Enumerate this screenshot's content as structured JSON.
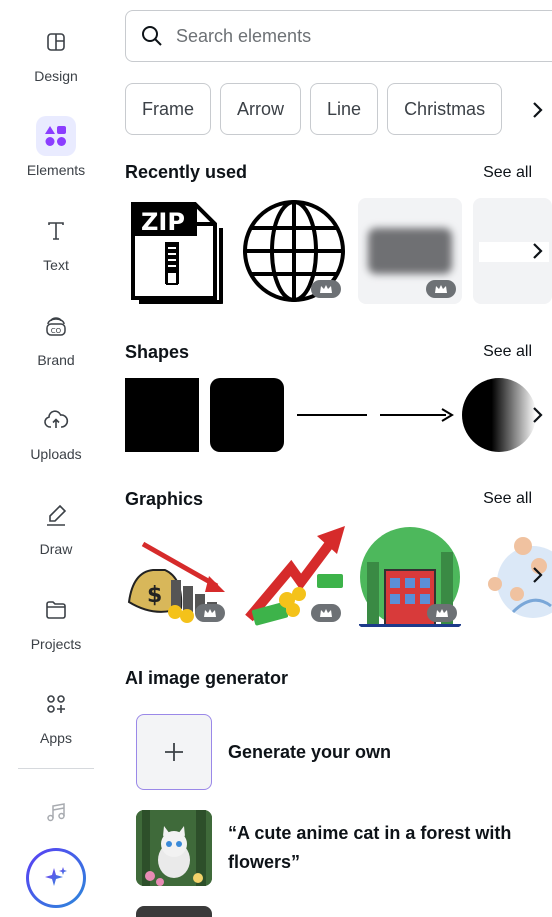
{
  "sidebar": {
    "items": [
      {
        "label": "Design",
        "icon": "design-icon"
      },
      {
        "label": "Elements",
        "icon": "elements-icon",
        "active": true
      },
      {
        "label": "Text",
        "icon": "text-icon"
      },
      {
        "label": "Brand",
        "icon": "brand-icon"
      },
      {
        "label": "Uploads",
        "icon": "uploads-icon"
      },
      {
        "label": "Draw",
        "icon": "draw-icon"
      },
      {
        "label": "Projects",
        "icon": "projects-icon"
      },
      {
        "label": "Apps",
        "icon": "apps-icon"
      }
    ],
    "extra_icons": [
      "music-icon",
      "magic-sparkle-icon"
    ]
  },
  "search": {
    "placeholder": "Search elements"
  },
  "chips": [
    "Frame",
    "Arrow",
    "Line",
    "Christmas"
  ],
  "sections": {
    "recently_used": {
      "title": "Recently used",
      "see_all": "See all"
    },
    "shapes": {
      "title": "Shapes",
      "see_all": "See all"
    },
    "graphics": {
      "title": "Graphics",
      "see_all": "See all"
    },
    "ai": {
      "title": "AI image generator"
    }
  },
  "recent_items": [
    {
      "name": "zip-file-icon",
      "label": "ZIP"
    },
    {
      "name": "globe-icon"
    },
    {
      "name": "blurred-rectangle"
    },
    {
      "name": "white-rectangle"
    }
  ],
  "ai_items": {
    "generate": "Generate your own",
    "prompt1": "“A cute anime cat in a forest with flowers”"
  },
  "colors": {
    "accent": "#8b3dff",
    "active_bg": "#e9ebff",
    "premium_badge": "#6d7175"
  }
}
